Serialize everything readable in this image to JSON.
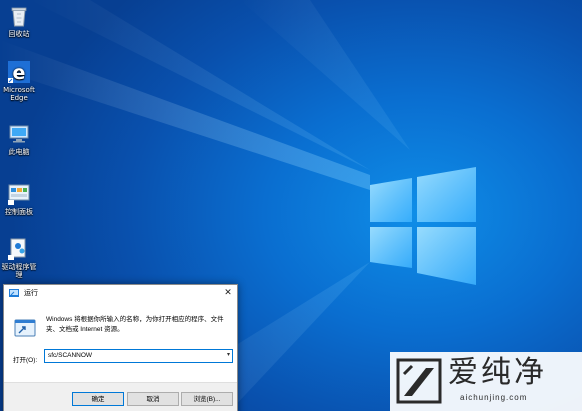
{
  "desktop": {
    "icons": [
      {
        "label": "回收站",
        "icon": "recycle-bin-icon"
      },
      {
        "label": "Microsoft Edge",
        "icon": "edge-icon"
      },
      {
        "label": "此电脑",
        "icon": "this-pc-icon"
      },
      {
        "label": "控制面板",
        "icon": "control-panel-icon"
      },
      {
        "label": "驱动程序管理",
        "icon": "driver-manager-icon"
      }
    ],
    "colors": {
      "wallpaper": "#0a6ed0",
      "accent": "#0078d7"
    }
  },
  "run_dialog": {
    "title": "运行",
    "close_glyph": "✕",
    "description": "Windows 将根据你所输入的名称，为你打开相应的程序、文件夹、文档或 Internet 资源。",
    "open_label": "打开(O):",
    "open_value": "sfc/SCANNOW",
    "dropdown_glyph": "▾",
    "buttons": {
      "ok": "确定",
      "cancel": "取消",
      "browse": "浏览(B)..."
    }
  },
  "watermark": {
    "text": "爱纯净",
    "url": "aichunjing.com"
  }
}
